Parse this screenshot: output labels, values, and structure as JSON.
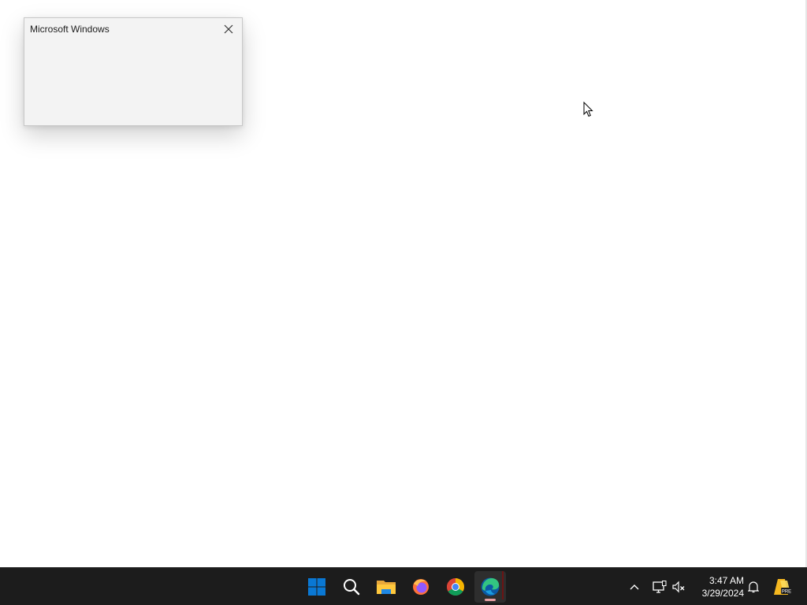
{
  "dialog": {
    "title": "Microsoft Windows"
  },
  "taskbar": {
    "apps": [
      "start-icon",
      "search-icon",
      "file-explorer-icon",
      "firefox-icon",
      "chrome-icon",
      "edge-icon"
    ],
    "active_app": "edge-icon"
  },
  "tray": {
    "time": "3:47 AM",
    "date": "3/29/2024",
    "icons": [
      "chevron-up-icon",
      "network-icon",
      "volume-muted-icon",
      "bell-icon",
      "copilot-pre-icon"
    ]
  },
  "colors": {
    "taskbar_bg": "#1c1c1c",
    "dialog_bg": "#f3f3f3",
    "windows_blue": "#0a78d4",
    "active_indicator": "#e8a0a4"
  }
}
